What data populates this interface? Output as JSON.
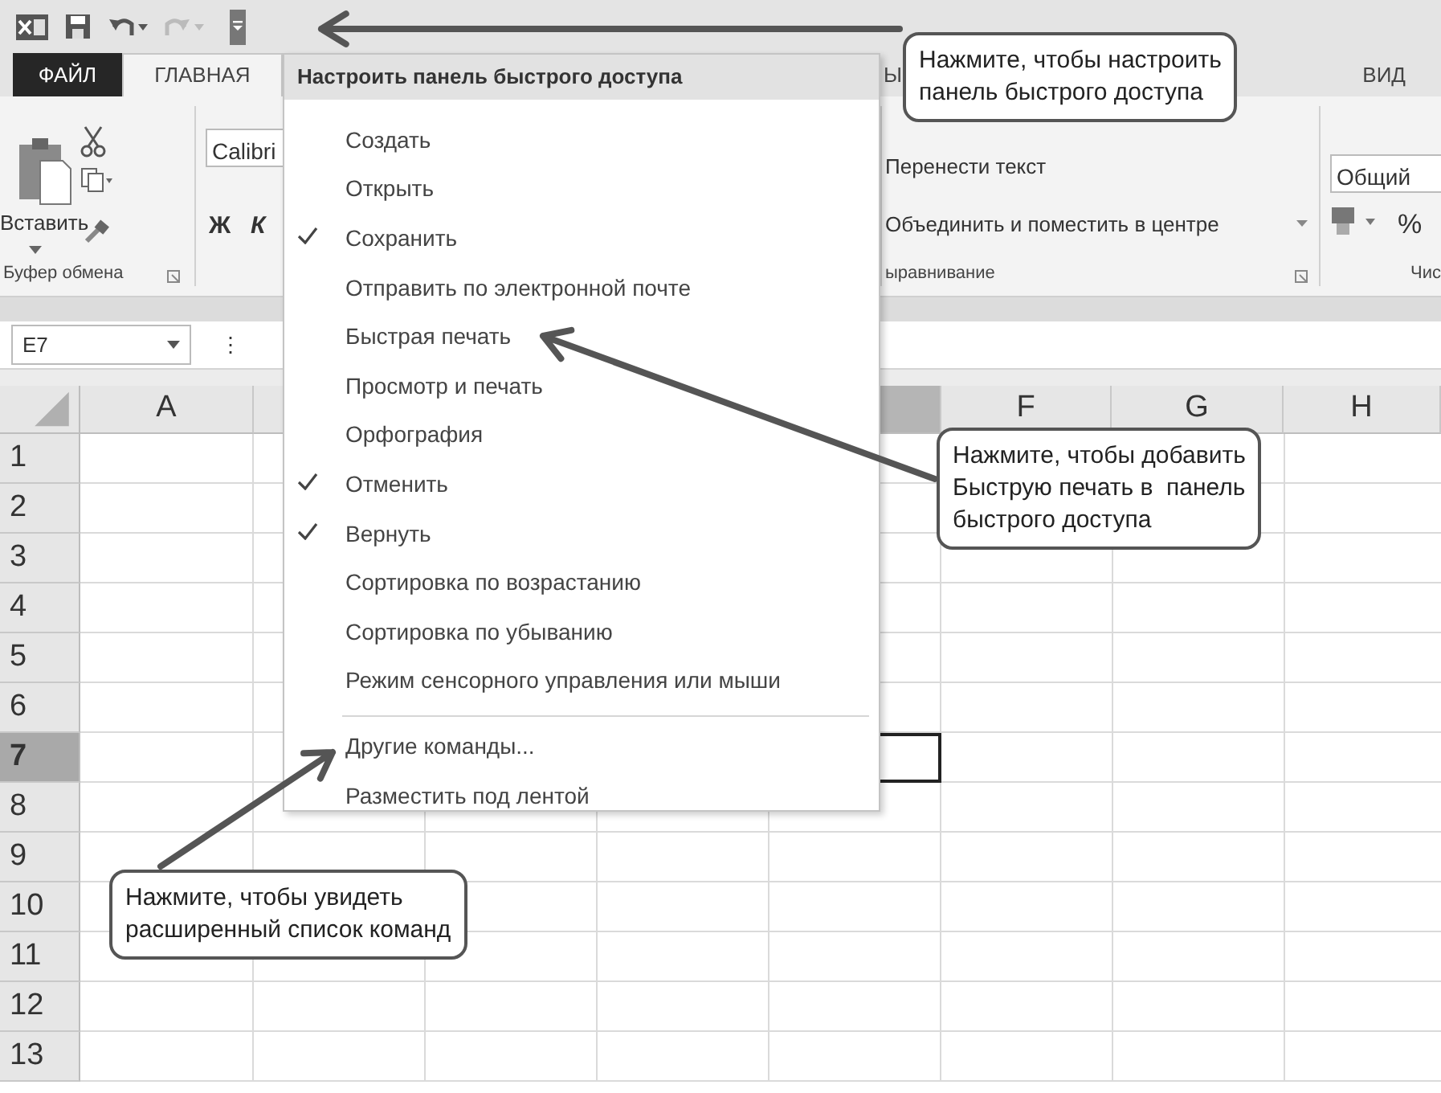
{
  "quick_access": [
    {
      "kind": "save",
      "disabled": false
    },
    {
      "kind": "undo",
      "disabled": false
    },
    {
      "kind": "redo",
      "disabled": true
    }
  ],
  "customize_button": {
    "pressed": true
  },
  "tabs": [
    {
      "label": "ФАЙЛ",
      "kind": "file",
      "selected": false
    },
    {
      "label": "ГЛАВНАЯ",
      "kind": "tab",
      "selected": true
    },
    {
      "label": "Ы",
      "kind": "tab",
      "selected": false
    },
    {
      "label": "ВИД",
      "kind": "tab",
      "selected": false
    }
  ],
  "ribbon": {
    "paste_label": "Вставить",
    "clipboard_group": "Буфер обмена",
    "font_name": "Calibri",
    "bold": "Ж",
    "italic": "К",
    "wrap_text": "Перенести текст",
    "merge_center": "Объединить и поместить в центре",
    "alignment_group": "ыравнивание",
    "number_format": "Общий",
    "percent": "%",
    "number_group": "Чис"
  },
  "name_box": "E7",
  "formula_separator": "⋮",
  "columns": [
    {
      "label": "A",
      "selected": false
    },
    {
      "selected": true
    },
    {
      "label": "F",
      "selected": false
    },
    {
      "label": "G",
      "selected": false
    },
    {
      "label": "H",
      "selected": false
    }
  ],
  "rows": [
    {
      "label": "1",
      "selected": false
    },
    {
      "label": "2",
      "selected": false
    },
    {
      "label": "3",
      "selected": false
    },
    {
      "label": "4",
      "selected": false
    },
    {
      "label": "5",
      "selected": false
    },
    {
      "label": "6",
      "selected": false
    },
    {
      "label": "7",
      "selected": true
    },
    {
      "label": "8",
      "selected": false
    },
    {
      "label": "9",
      "selected": false
    },
    {
      "label": "10",
      "selected": false
    },
    {
      "label": "11",
      "selected": false
    },
    {
      "label": "12",
      "selected": false
    },
    {
      "label": "13",
      "selected": false
    }
  ],
  "menu": {
    "title": "Настроить панель быстрого доступа",
    "items": [
      {
        "kind": "item",
        "label": "Создать",
        "checked": false
      },
      {
        "kind": "item",
        "label": "Открыть",
        "checked": false
      },
      {
        "kind": "item",
        "label": "Сохранить",
        "checked": true
      },
      {
        "kind": "item",
        "label": "Отправить по электронной почте",
        "checked": false
      },
      {
        "kind": "item",
        "label": "Быстрая печать",
        "checked": false
      },
      {
        "kind": "item",
        "label": "Просмотр и печать",
        "checked": false
      },
      {
        "kind": "item",
        "label": "Орфография",
        "checked": false
      },
      {
        "kind": "item",
        "label": "Отменить",
        "checked": true
      },
      {
        "kind": "item",
        "label": "Вернуть",
        "checked": true
      },
      {
        "kind": "item",
        "label": "Сортировка по возрастанию",
        "checked": false
      },
      {
        "kind": "item",
        "label": "Сортировка по убыванию",
        "checked": false
      },
      {
        "kind": "item",
        "label": "Режим сенсорного управления или мыши",
        "checked": false
      },
      {
        "kind": "separator"
      },
      {
        "kind": "item",
        "label": "Другие команды...",
        "checked": false
      },
      {
        "kind": "item",
        "label": "Разместить под лентой",
        "checked": false
      }
    ]
  },
  "callouts": [
    {
      "lines": [
        "Нажмите, чтобы настроить",
        "панель быстрого доступа"
      ]
    },
    {
      "lines": [
        "Нажмите, чтобы добавить",
        "Быструю печать в  панель",
        "быстрого доступа"
      ]
    },
    {
      "lines": [
        "Нажмите, чтобы увидеть",
        "расширенный список команд"
      ]
    }
  ]
}
